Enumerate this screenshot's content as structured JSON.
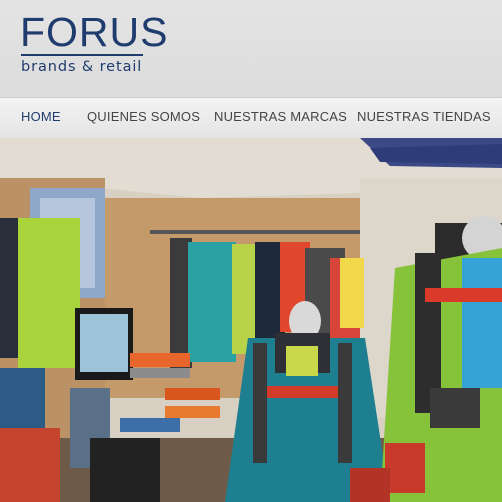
{
  "brand": {
    "name": "FORUS",
    "tagline": "brands & retail",
    "color": "#1f3c6e"
  },
  "nav": {
    "items": [
      {
        "label": "HOME",
        "active": true
      },
      {
        "label": "QUIENES SOMOS",
        "active": false
      },
      {
        "label": "NUESTRAS MARCAS",
        "active": false
      },
      {
        "label": "NUESTRAS TIENDAS",
        "active": false
      }
    ]
  },
  "hero": {
    "description_icon": "store-interior-photo"
  }
}
